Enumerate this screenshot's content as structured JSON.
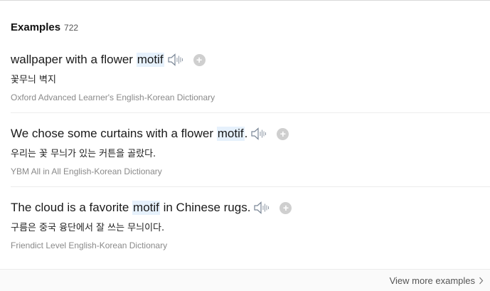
{
  "header": {
    "title": "Examples",
    "count": "722"
  },
  "examples": [
    {
      "before": "wallpaper with a flower ",
      "keyword": "motif",
      "after": "",
      "translation": "꽃무늬 벽지",
      "source": "Oxford Advanced Learner's English-Korean Dictionary"
    },
    {
      "before": "We chose some curtains with a flower ",
      "keyword": "motif",
      "after": ".",
      "translation": "우리는 꽃 무늬가 있는 커튼을 골랐다.",
      "source": "YBM All in All English-Korean Dictionary"
    },
    {
      "before": "The cloud is a favorite ",
      "keyword": "motif",
      "after": " in Chinese rugs.",
      "translation": "구름은 중국 융단에서 잘 쓰는 무늬이다.",
      "source": "Friendict Level English-Korean Dictionary"
    }
  ],
  "icons": {
    "speaker": "speaker-icon",
    "add": "plus-icon",
    "more": "chevron-right-icon"
  },
  "colors": {
    "highlight": "#e6f1fc",
    "source_text": "#8a8a8a",
    "add_button": "#cfcfcf"
  },
  "footer": {
    "more_label": "View more examples"
  }
}
